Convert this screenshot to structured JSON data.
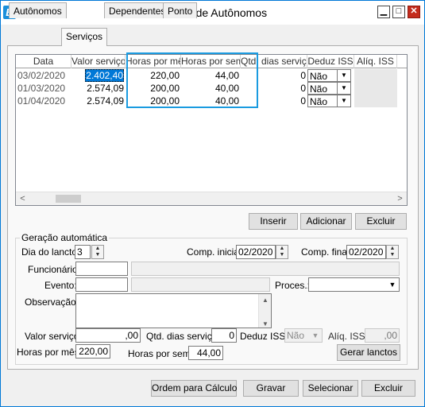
{
  "window": {
    "title": "Cadastro de Autônomos",
    "app_icon_letter": "B",
    "minimize_glyph": "▁",
    "maximize_glyph": "□",
    "close_glyph": "✕"
  },
  "tabs": [
    "Autônomos",
    "Serviços",
    "Dependentes",
    "Ponto"
  ],
  "active_tab": "Serviços",
  "grid": {
    "columns": [
      "Data",
      "Valor serviço",
      "Horas por mês",
      "Horas por sem.",
      "Qtd. dias serviço",
      "Deduz ISS",
      "Alíq. ISS"
    ],
    "rows": [
      {
        "data": "03/02/2020",
        "valor": "2.402,40",
        "horas_mes": "220,00",
        "horas_sem": "44,00",
        "qtd_dias": "0",
        "deduz": "Não",
        "aliq": ""
      },
      {
        "data": "01/03/2020",
        "valor": "2.574,09",
        "horas_mes": "200,00",
        "horas_sem": "40,00",
        "qtd_dias": "0",
        "deduz": "Não",
        "aliq": ""
      },
      {
        "data": "01/04/2020",
        "valor": "2.574,09",
        "horas_mes": "200,00",
        "horas_sem": "40,00",
        "qtd_dias": "0",
        "deduz": "Não",
        "aliq": ""
      }
    ],
    "dropdown_glyph": "▼",
    "scroll_left_glyph": "<",
    "scroll_right_glyph": ">"
  },
  "grid_buttons": {
    "inserir": "Inserir",
    "adicionar": "Adicionar",
    "excluir": "Excluir"
  },
  "geracao": {
    "title": "Geração automática",
    "dia_lancto_label": "Dia do lancto:",
    "dia_lancto_value": "3",
    "comp_inicial_label": "Comp. inicial:",
    "comp_inicial_value": "02/2020",
    "comp_final_label": "Comp. final:",
    "comp_final_value": "02/2020",
    "funcionario_label": "Funcionário:",
    "funcionario_value": "",
    "evento_label": "Evento:",
    "evento_value": "",
    "proces_label": "Proces.:",
    "proces_value": "",
    "observacao_label": "Observação:",
    "observacao_value": "",
    "valor_servico_label": "Valor serviço:",
    "valor_servico_value": ",00",
    "qtd_dias_label": "Qtd. dias serviço:",
    "qtd_dias_value": "0",
    "deduz_iss_label": "Deduz ISS:",
    "deduz_iss_value": "Não",
    "aliq_iss_label": "Alíq. ISS:",
    "aliq_iss_value": ",00",
    "horas_mes_label": "Horas por mês:",
    "horas_mes_value": "220,00",
    "horas_sem_label": "Horas por sem.:",
    "horas_sem_value": "44,00",
    "gerar_button": "Gerar lanctos",
    "spin_up": "▲",
    "spin_down": "▼"
  },
  "footer_buttons": {
    "ordem": "Ordem para Cálculo",
    "gravar": "Gravar",
    "selecionar": "Selecionar",
    "excluir": "Excluir"
  },
  "colors": {
    "selection": "#0078d7",
    "highlight_box": "#1a9be0",
    "close_button": "#c42b1c"
  }
}
